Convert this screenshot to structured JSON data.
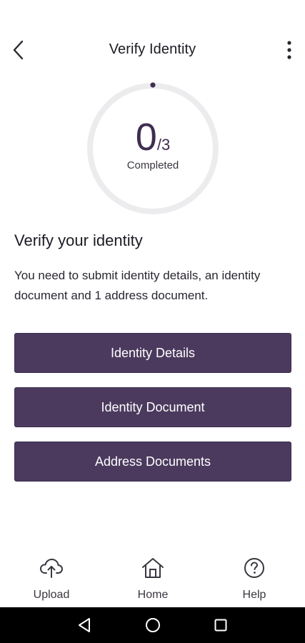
{
  "header": {
    "title": "Verify Identity",
    "back_icon": "chevron-left-icon",
    "more_icon": "more-vertical-icon"
  },
  "progress": {
    "completed": "0",
    "total": "/3",
    "label": "Completed",
    "fraction": 0,
    "ring_color": "#ececee",
    "dot_color": "#3f2d52"
  },
  "section": {
    "title": "Verify your identity",
    "description": "You need to submit identity details, an identity document and 1 address document."
  },
  "actions": {
    "identity_details": "Identity Details",
    "identity_document": "Identity Document",
    "address_documents": "Address Documents"
  },
  "colors": {
    "button_bg": "#4b3a5e",
    "button_text": "#ffffff"
  },
  "bottom_nav": {
    "upload": "Upload",
    "home": "Home",
    "help": "Help"
  },
  "system_nav": {
    "back": "triangle-back-icon",
    "home": "circle-home-icon",
    "recent": "square-recents-icon"
  }
}
